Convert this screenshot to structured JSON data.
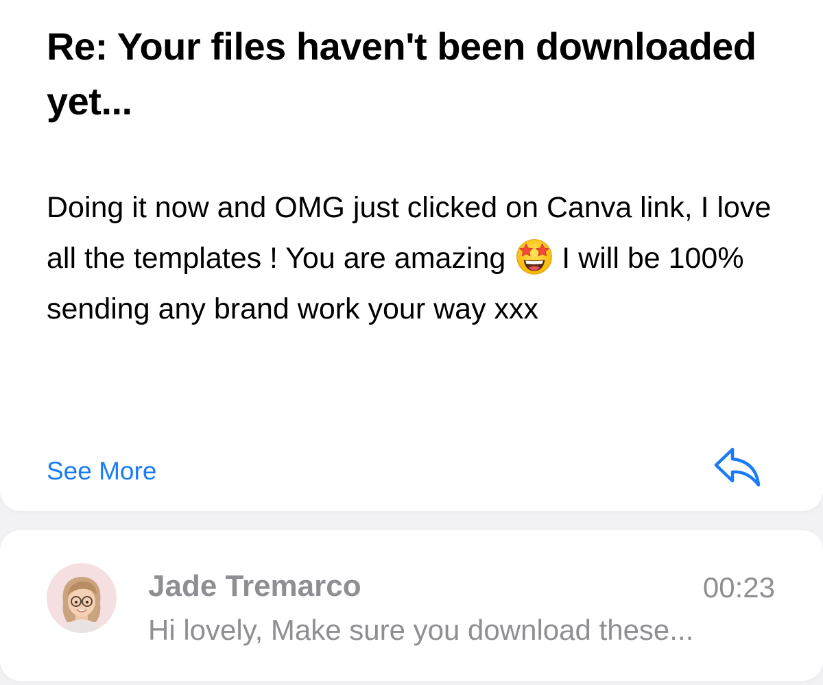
{
  "message": {
    "subject": "Re: Your files haven't been downloaded yet...",
    "body_before_emoji": "Doing it now and OMG just clicked on Canva link, I love all the templates ! You are amazing ",
    "body_emoji": "star-struck-emoji",
    "body_after_emoji": "I will be 100% sending any brand work your way xxx",
    "see_more_label": "See More",
    "reply_icon": "reply-icon",
    "link_color": "#1a7cf4"
  },
  "thread": [
    {
      "sender": "Jade Tremarco",
      "time": "00:23",
      "preview": "Hi lovely, Make sure you download these...",
      "avatar_icon": "memoji-avatar"
    }
  ]
}
